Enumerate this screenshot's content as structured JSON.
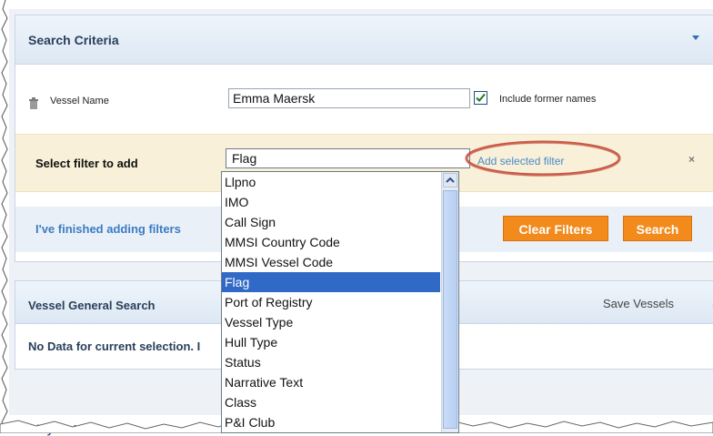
{
  "search_criteria": {
    "title": "Search Criteria",
    "vessel_name_label": "Vessel Name",
    "vessel_name_value": "Emma Maersk",
    "include_former_names_label": "Include former names",
    "include_former_names_checked": true
  },
  "filter_bar": {
    "label": "Select filter to add",
    "selected_value": "Flag",
    "add_link": "Add selected filter",
    "close": "×"
  },
  "actions": {
    "finished_link": "I've finished adding filters",
    "clear_button": "Clear Filters",
    "search_button": "Search"
  },
  "vessel_panel": {
    "title": "Vessel General Search",
    "save_vessels": "Save Vessels",
    "more": "S",
    "no_data": "No Data for current selection. I"
  },
  "footer_text": "Lloyd's List",
  "dropdown": {
    "options": [
      "Llpno",
      "IMO",
      "Call Sign",
      "MMSI Country Code",
      "MMSI Vessel Code",
      "Flag",
      "Port of Registry",
      "Vessel Type",
      "Hull Type",
      "Status",
      "Narrative Text",
      "Class",
      "P&I Club"
    ],
    "selected_index": 5
  },
  "colors": {
    "accent_orange": "#f28a1c",
    "link_blue": "#3b7cc1",
    "selected_blue": "#3169c6",
    "highlight_red": "#c0392b"
  }
}
